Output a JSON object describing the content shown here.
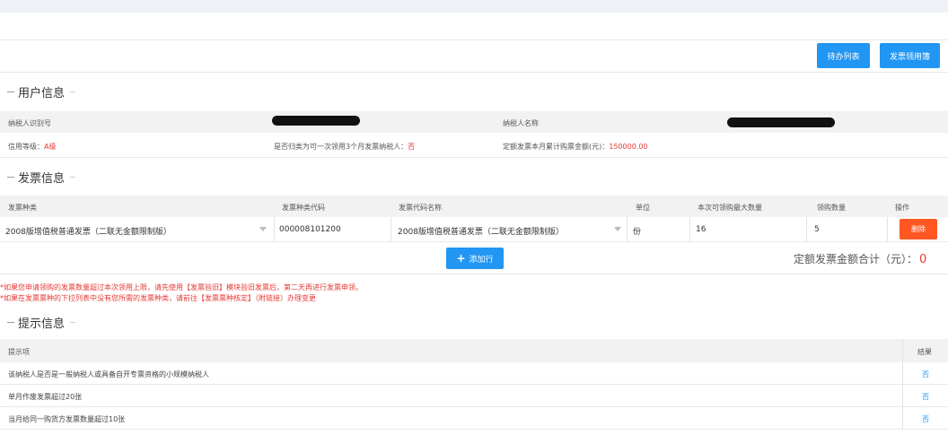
{
  "toolbar": {
    "todo_label": "待办列表",
    "apply_label": "发票领用簿"
  },
  "user_info": {
    "title": "用户信息",
    "taxpayer_id_label": "纳税人识别号",
    "taxpayer_name_label": "纳税人名称",
    "credit_label": "信用等级：",
    "credit_value": "A级",
    "three_month_label": "是否归类为可一次领用3个月发票纳税人：",
    "three_month_value": "否",
    "quota_label": "定额发票本月累计购票金额(元)：",
    "quota_value": "150000.00"
  },
  "invoice_info": {
    "title": "发票信息",
    "columns": [
      "发票种类",
      "发票种类代码",
      "发票代码名称",
      "单位",
      "本次可领购最大数量",
      "领购数量",
      "操作"
    ],
    "rows": [
      {
        "type": "2008版增值税普通发票（二联无金额限制版）",
        "type_code": "000008101200",
        "code_name": "2008版增值税普通发票（二联无金额限制版）",
        "unit": "份",
        "max_qty": "16",
        "qty": "5",
        "action": "删除"
      }
    ],
    "add_label": "添加行",
    "total_label": "定额发票金额合计（元）：",
    "total_value": "0"
  },
  "notes": [
    "*如果您申请领购的发票数量超过本次领用上限，请先使用【发票验旧】模块验旧发票后，第二天再进行发票申领。",
    "*如果在发票票种的下拉列表中没有您所需的发票种类，请前往【发票票种核定】（附链接）办理变更"
  ],
  "hints": {
    "title": "提示信息",
    "col_item": "提示项",
    "col_result": "结果",
    "rows": [
      {
        "item": "该纳税人是否是一般纳税人或具备自开专票资格的小规模纳税人",
        "result": "否"
      },
      {
        "item": "单月作废发票超过20张",
        "result": "否"
      },
      {
        "item": "当月给同一购货方发票数量超过10张",
        "result": "否"
      }
    ]
  },
  "colors": {
    "primary": "#2196f3",
    "danger": "#ff5722",
    "alert": "#e53935"
  }
}
